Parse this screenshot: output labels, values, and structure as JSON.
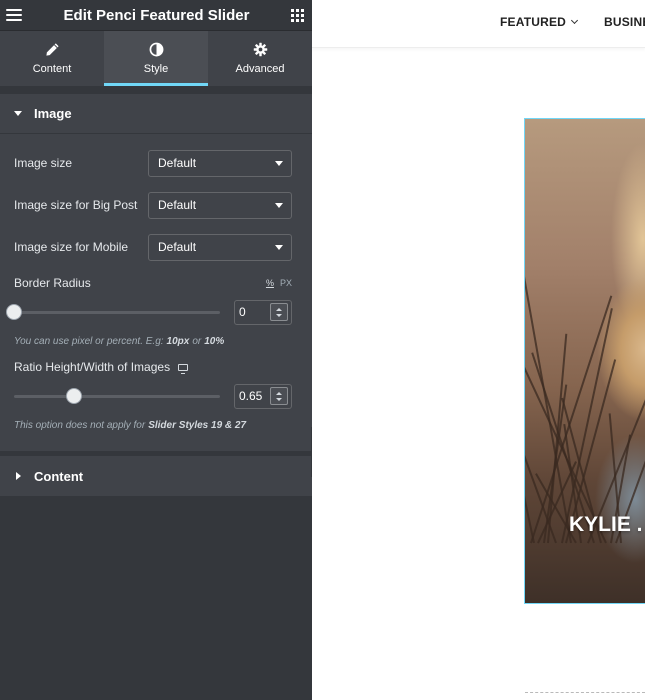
{
  "panel": {
    "title": "Edit Penci Featured Slider",
    "tabs": [
      {
        "label": "Content",
        "icon": "pencil-icon",
        "active": false
      },
      {
        "label": "Style",
        "icon": "contrast-icon",
        "active": true
      },
      {
        "label": "Advanced",
        "icon": "gear-icon",
        "active": false
      }
    ],
    "accent_color": "#71d7f7"
  },
  "image_section": {
    "heading": "Image",
    "controls": [
      {
        "label": "Image size",
        "value": "Default"
      },
      {
        "label": "Image size for Big Post",
        "value": "Default"
      },
      {
        "label": "Image size for Mobile",
        "value": "Default"
      }
    ],
    "border_radius": {
      "label": "Border Radius",
      "unit_percent": "%",
      "unit_px": "PX",
      "value": "0",
      "level": 0,
      "help_prefix": "You can use pixel or percent. E.g:",
      "help_ex1": "10px",
      "help_or": "or",
      "help_ex2": "10%"
    },
    "ratio": {
      "label": "Ratio Height/Width of Images",
      "value": "0.65",
      "level": 0.29,
      "help_prefix": "This option does not apply for",
      "help_bold": "Slider Styles 19 & 27"
    }
  },
  "content_section": {
    "heading": "Content"
  },
  "site": {
    "nav": [
      "FEATURED",
      "BUSINE"
    ],
    "slide_title": "KYLIE ."
  }
}
